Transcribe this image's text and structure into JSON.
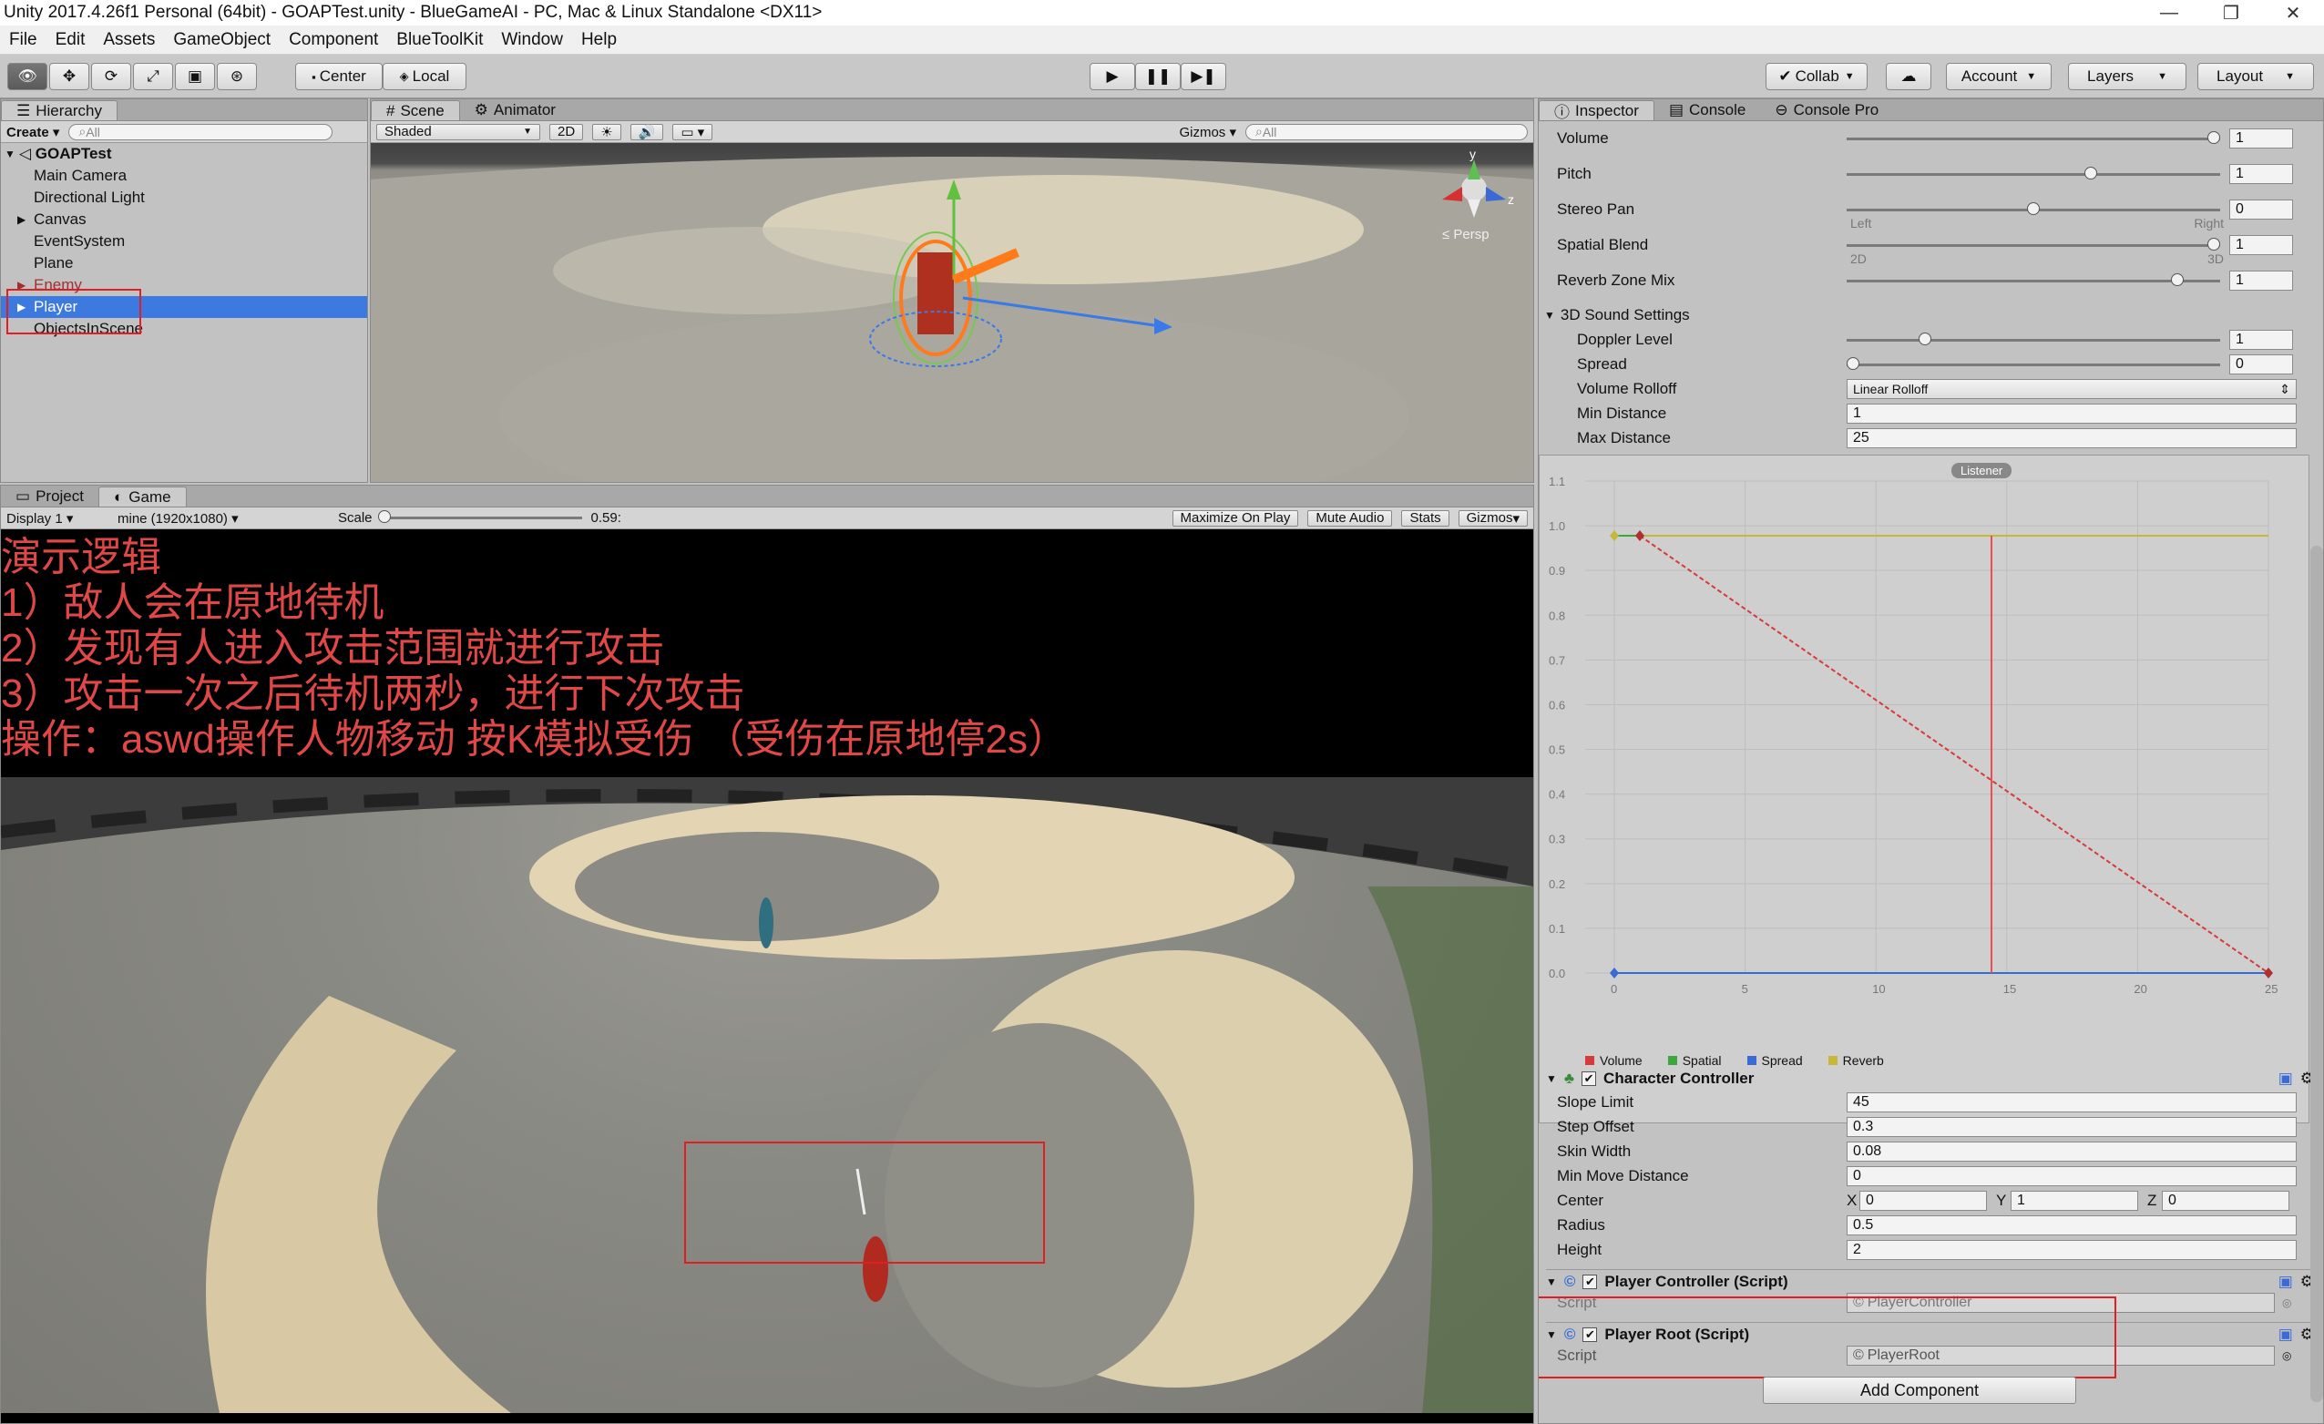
{
  "window": {
    "title": "Unity 2017.4.26f1 Personal (64bit) - GOAPTest.unity - BlueGameAI - PC, Mac & Linux Standalone <DX11>",
    "minimize": "—",
    "restore": "❐",
    "close": "✕"
  },
  "menu": [
    "File",
    "Edit",
    "Assets",
    "GameObject",
    "Component",
    "BlueToolKit",
    "Window",
    "Help"
  ],
  "toolbar": {
    "center": "Center",
    "local": "Local",
    "collab": "Collab",
    "account": "Account",
    "layers": "Layers",
    "layout": "Layout"
  },
  "hierarchy": {
    "tab": "Hierarchy",
    "create": "Create",
    "search_placeholder": "All",
    "scene_name": "GOAPTest",
    "items": [
      {
        "label": "Main Camera"
      },
      {
        "label": "Directional Light"
      },
      {
        "label": "Canvas"
      },
      {
        "label": "EventSystem"
      },
      {
        "label": "Plane"
      },
      {
        "label": "Enemy"
      },
      {
        "label": "Player"
      },
      {
        "label": "ObjectsInScene"
      }
    ]
  },
  "scene": {
    "tab_scene": "Scene",
    "tab_animator": "Animator",
    "shading": "Shaded",
    "mode_2d": "2D",
    "gizmos": "Gizmos",
    "search_placeholder": "All",
    "gizmo_y": "y",
    "gizmo_z": "z",
    "persp": "Persp"
  },
  "game": {
    "tab_project": "Project",
    "tab_game": "Game",
    "display": "Display 1",
    "resolution": "mine (1920x1080)",
    "scale_label": "Scale",
    "scale_value": "0.59:",
    "maximize": "Maximize On Play",
    "mute": "Mute Audio",
    "stats": "Stats",
    "gizmos": "Gizmos",
    "overlay_lines": [
      "演示逻辑",
      "1）敌人会在原地待机",
      "2）发现有人进入攻击范围就进行攻击",
      "3）攻击一次之后待机两秒，进行下次攻击",
      "操作：aswd操作人物移动 按K模拟受伤 （受伤在原地停2s）"
    ]
  },
  "inspector": {
    "tab_inspector": "Inspector",
    "tab_console": "Console",
    "tab_console_pro": "Console Pro",
    "audio": {
      "volume_label": "Volume",
      "volume": "1",
      "volume_level": 1.0,
      "pitch_label": "Pitch",
      "pitch": "1",
      "pitch_level": 0.66,
      "stereo_label": "Stereo Pan",
      "stereo": "0",
      "stereo_level": 0.5,
      "stereo_left": "Left",
      "stereo_right": "Right",
      "spatial_label": "Spatial Blend",
      "spatial": "1",
      "spatial_level": 1.0,
      "spatial_2d": "2D",
      "spatial_3d": "3D",
      "reverb_label": "Reverb Zone Mix",
      "reverb": "1",
      "reverb_level": 0.9
    },
    "sound3d": {
      "header": "3D Sound Settings",
      "doppler_label": "Doppler Level",
      "doppler": "1",
      "doppler_level": 0.2,
      "spread_label": "Spread",
      "spread": "0",
      "spread_level": 0.0,
      "rolloff_label": "Volume Rolloff",
      "rolloff": "Linear Rolloff",
      "min_label": "Min Distance",
      "min": "1",
      "max_label": "Max Distance",
      "max": "25"
    },
    "curve": {
      "listener": "Listener",
      "y_ticks": [
        "1.1",
        "1.0",
        "0.9",
        "0.8",
        "0.7",
        "0.6",
        "0.5",
        "0.4",
        "0.3",
        "0.2",
        "0.1",
        "0.0"
      ],
      "x_ticks": [
        "0",
        "5",
        "10",
        "15",
        "20",
        "25"
      ],
      "legend": [
        "Volume",
        "Spatial",
        "Spread",
        "Reverb"
      ],
      "legend_colors": [
        "#d63a3a",
        "#3aa83a",
        "#3a6ad6",
        "#c8b83a"
      ]
    },
    "character_controller": {
      "title": "Character Controller",
      "slope_label": "Slope Limit",
      "slope": "45",
      "step_label": "Step Offset",
      "step": "0.3",
      "skin_label": "Skin Width",
      "skin": "0.08",
      "minmove_label": "Min Move Distance",
      "minmove": "0",
      "center_label": "Center",
      "cx_label": "X",
      "cx": "0",
      "cy_label": "Y",
      "cy": "1",
      "cz_label": "Z",
      "cz": "0",
      "radius_label": "Radius",
      "radius": "0.5",
      "height_label": "Height",
      "height": "2"
    },
    "player_controller": {
      "title": "Player Controller (Script)",
      "script_label": "Script",
      "script": "PlayerController"
    },
    "player_root": {
      "title": "Player Root (Script)",
      "script_label": "Script",
      "script": "PlayerRoot"
    },
    "add_component": "Add Component"
  }
}
